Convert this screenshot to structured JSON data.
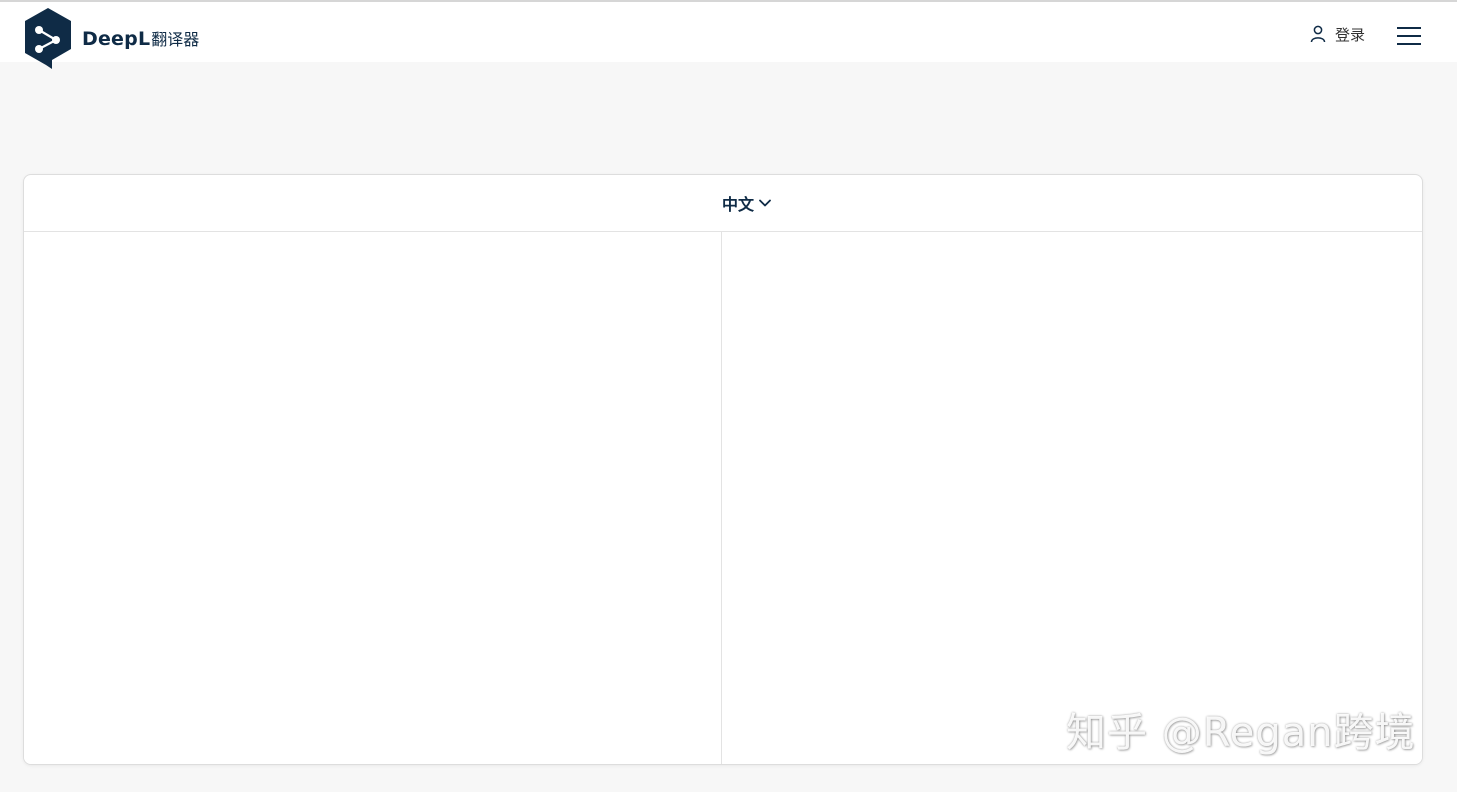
{
  "header": {
    "brand_name": "DeepL",
    "brand_suffix": "翻译器",
    "login_label": "登录",
    "logo_icon": "deepl-logo-icon",
    "user_icon": "user-icon",
    "menu_icon": "hamburger-menu-icon"
  },
  "translator": {
    "target_language": "中文",
    "dropdown_icon": "chevron-down-icon"
  },
  "watermark": "知乎 @Regan跨境",
  "colors": {
    "brand_navy": "#0f2b46",
    "page_background": "#f7f7f7",
    "panel_background": "#ffffff",
    "border": "#e3e3e3"
  }
}
